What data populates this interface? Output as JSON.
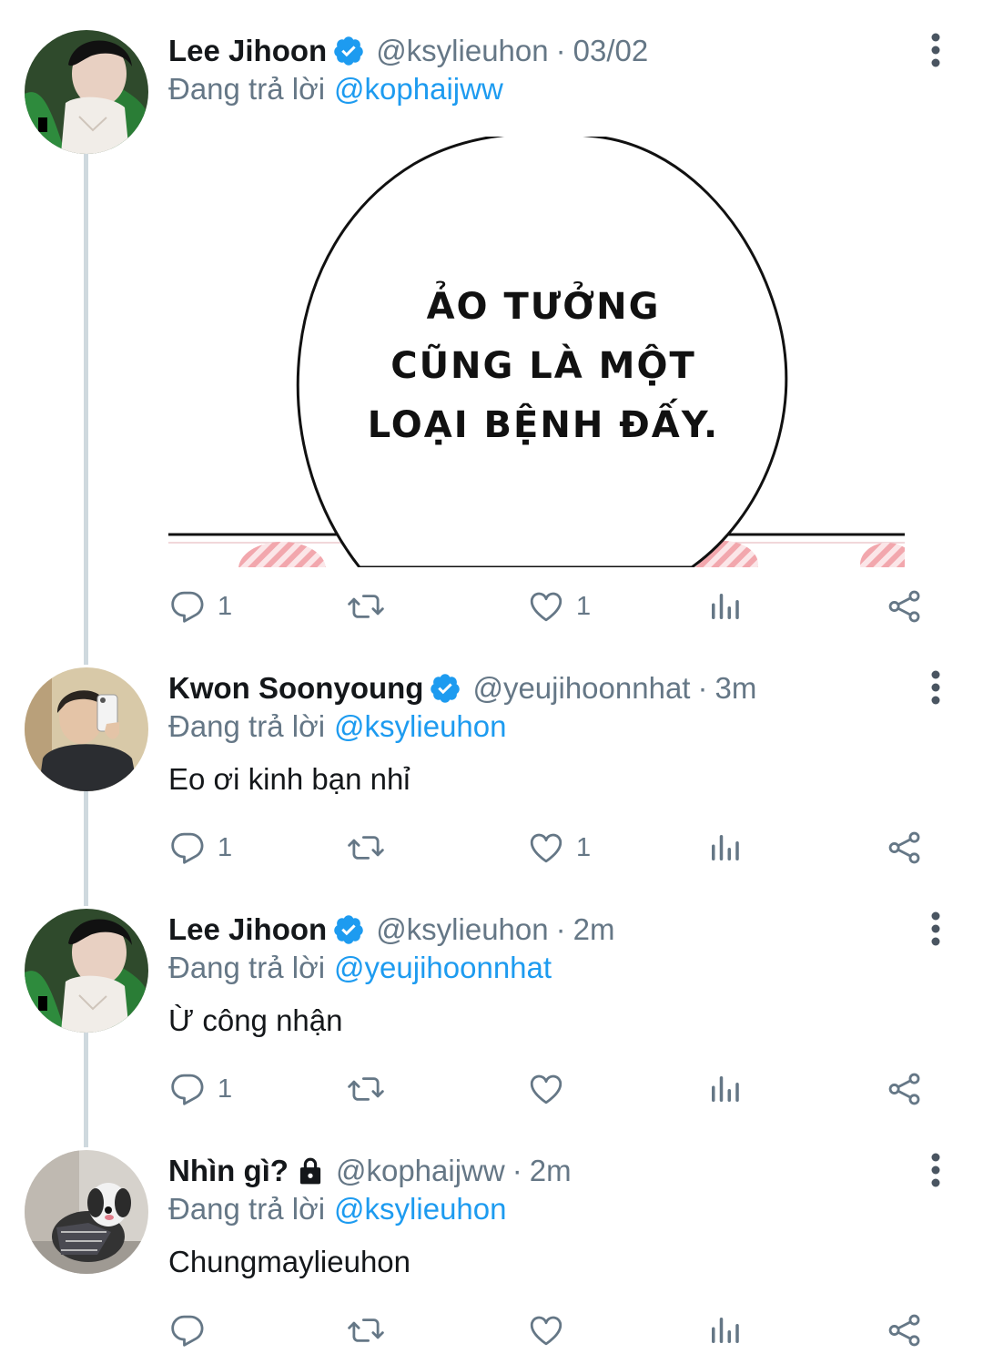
{
  "tweets": [
    {
      "name": "Lee Jihoon",
      "verified": true,
      "handle": "@ksylieuhon",
      "sep": "·",
      "time": "03/02",
      "reply_label": "Đang trả lời",
      "reply_to": "@kophaijww",
      "text": "",
      "image_text": [
        "ẢO TƯỞNG",
        "CŨNG LÀ MỘT",
        "LOẠI BỆNH ĐẤY."
      ],
      "reply_count": "1",
      "like_count": "1"
    },
    {
      "name": "Kwon Soonyoung",
      "verified": true,
      "handle": "@yeujihoonnhat",
      "sep": "·",
      "time": "3m",
      "reply_label": "Đang trả lời",
      "reply_to": "@ksylieuhon",
      "text": "Eo ơi kinh bạn nhỉ",
      "reply_count": "1",
      "like_count": "1"
    },
    {
      "name": "Lee Jihoon",
      "verified": true,
      "handle": "@ksylieuhon",
      "sep": "·",
      "time": "2m",
      "reply_label": "Đang trả lời",
      "reply_to": "@yeujihoonnhat",
      "text": "Ừ công nhận",
      "reply_count": "1",
      "like_count": ""
    },
    {
      "name": "Nhìn gì?",
      "verified": false,
      "protected": true,
      "handle": "@kophaijww",
      "sep": "·",
      "time": "2m",
      "reply_label": "Đang trả lời",
      "reply_to": "@ksylieuhon",
      "text": "Chungmaylieuhon",
      "reply_count": "",
      "like_count": ""
    }
  ],
  "colors": {
    "accent": "#1d9bf0",
    "muted": "#657786",
    "text": "#14171a",
    "thread_line": "#cfd9de"
  },
  "icons": [
    "verified-badge-icon",
    "lock-icon",
    "more-vertical-icon",
    "reply-icon",
    "retweet-icon",
    "like-icon",
    "analytics-icon",
    "share-icon"
  ]
}
